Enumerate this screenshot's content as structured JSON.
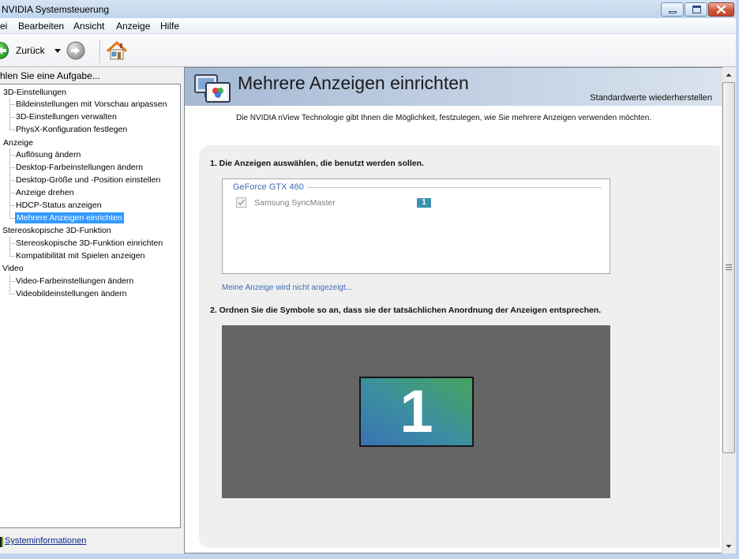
{
  "window": {
    "title": "NVIDIA Systemsteuerung"
  },
  "menu": {
    "items": [
      "ei",
      "Bearbeiten",
      "Ansicht",
      "Anzeige",
      "Hilfe"
    ]
  },
  "toolbar": {
    "back_label": "Zurück"
  },
  "sidebar": {
    "header": "hlen Sie eine Aufgabe...",
    "tree": [
      {
        "label": "3D-Einstellungen",
        "children": [
          "Bildeinstellungen mit Vorschau anpassen",
          "3D-Einstellungen verwalten",
          "PhysX-Konfiguration festlegen"
        ]
      },
      {
        "label": "Anzeige",
        "children": [
          "Auflösung ändern",
          "Desktop-Farbeinstellungen ändern",
          "Desktop-Größe und -Position einstellen",
          "Anzeige drehen",
          "HDCP-Status anzeigen",
          "Mehrere Anzeigen einrichten"
        ]
      },
      {
        "label": "Stereoskopische 3D-Funktion",
        "children": [
          "Stereoskopische 3D-Funktion einrichten",
          "Kompatibilität mit Spielen anzeigen"
        ]
      },
      {
        "label": "Video",
        "children": [
          "Video-Farbeinstellungen ändern",
          "Videobildeinstellungen ändern"
        ]
      }
    ],
    "selected": {
      "category": 1,
      "item": 5
    },
    "system_info_link": "Systeminformationen"
  },
  "main": {
    "page_title": "Mehrere Anzeigen einrichten",
    "restore_defaults": "Standardwerte wiederherstellen",
    "description": "Die NVIDIA nView Technologie gibt Ihnen die Möglichkeit, festzulegen, wie Sie mehrere Anzeigen verwenden möchten.",
    "section1": {
      "title": "1. Die Anzeigen auswählen, die benutzt werden sollen.",
      "gpu_name": "GeForce GTX 460",
      "displays": [
        {
          "name": "Samsung SyncMaster",
          "number": "1",
          "checked": true,
          "enabled": false
        }
      ]
    },
    "missing_display_link": "Meine Anzeige wird nicht angezeigt...",
    "section2": {
      "title": "2. Ordnen Sie die Symbole so an, dass sie der tatsächlichen Anordnung der Anzeigen entsprechen.",
      "arrangement": [
        {
          "number": "1"
        }
      ]
    }
  },
  "colors": {
    "selection": "#3399ff",
    "display_badge": "#3993b0",
    "arrangement_background": "#656565",
    "link": "#3a6db5",
    "group_header": "#3c6db4"
  },
  "icons": {
    "back": "back-arrow-icon",
    "forward": "forward-arrow-icon",
    "dropdown": "chevron-down-icon",
    "home": "home-icon",
    "page": "multiple-displays-icon",
    "system_info": "system-info-icon"
  }
}
